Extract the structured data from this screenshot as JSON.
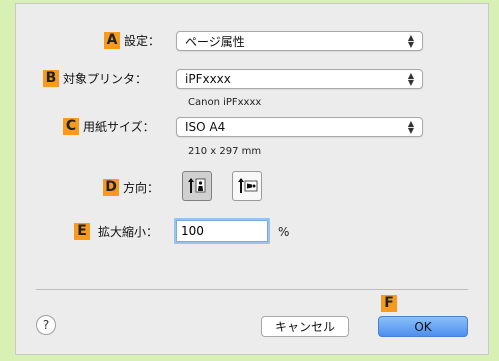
{
  "badges": {
    "a": "A",
    "b": "B",
    "c": "C",
    "d": "D",
    "e": "E",
    "f": "F"
  },
  "settings": {
    "label": "設定：",
    "value": "ページ属性"
  },
  "printer": {
    "label": "対象プリンタ：",
    "value": "iPFxxxx",
    "sub": "Canon iPFxxxx"
  },
  "paper": {
    "label": "用紙サイズ：",
    "value": "ISO A4",
    "sub": "210 x 297 mm"
  },
  "orientation": {
    "label": "方向：",
    "selected": "portrait"
  },
  "scale": {
    "label": "拡大縮小：",
    "value": "100",
    "unit": "%"
  },
  "buttons": {
    "cancel": "キャンセル",
    "ok": "OK",
    "help": "?"
  },
  "colors": {
    "background": "#d8f0b4",
    "badge": "#f79a1e",
    "ok_button": "#5a9cf2"
  }
}
